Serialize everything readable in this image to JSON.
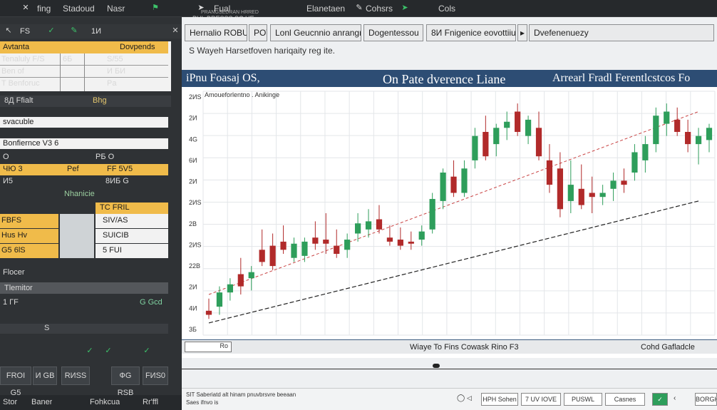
{
  "topbar": {
    "items": [
      "fing",
      "Stadoud",
      "Nasr",
      "Fual",
      "Elanetaen",
      "Cohsrs",
      "Cols"
    ],
    "subtitle": "PHI. BRESSS   SC HE",
    "tiny": "PRANGSEDRAN HRRED"
  },
  "left": {
    "toolbar": [
      "FS",
      "✓",
      "1И"
    ],
    "table": {
      "header_left": "Avtanta",
      "header_right": "Dovpends",
      "rows": [
        {
          "a": "Tenaluly F/S",
          "b": "6Б",
          "c": "S/55"
        },
        {
          "a": "Ben of",
          "b": "",
          "c": "И БИ"
        },
        {
          "a": "T Benforuc",
          "b": "",
          "c": "Pa"
        }
      ]
    },
    "section1": {
      "title": "Bhg",
      "label": "8Д Ffialt",
      "item1": "svacuble",
      "item2": "Bonfiernce V3 6"
    },
    "row_o": {
      "left": "O",
      "right": "PБ O"
    },
    "yellow_row": {
      "a": "ЧЮ 3",
      "b": "Pef",
      "c": "FF 5V5"
    },
    "small_row": {
      "left": "И5",
      "right": "8ИБ G"
    },
    "section2": {
      "title": "Nhanicie",
      "right_title": "TC FRIL"
    },
    "grid2": [
      {
        "a": "FBFS",
        "b": "SIV/AS"
      },
      {
        "a": "Hus Hv",
        "b": "SUICIB"
      },
      {
        "a": "G5 6lS",
        "b": "5 FUI"
      }
    ],
    "fields": {
      "label": "Flocer",
      "input": "Tlemitor"
    },
    "row_b": {
      "left": "1 ГF",
      "right": "G Gcd"
    },
    "row_c": {
      "value": "S"
    },
    "bottom_buttons": [
      "FROI G5",
      "И GB",
      "RИSS",
      "ФG RSB",
      "FИS0"
    ],
    "footer": [
      "Stor",
      "Baner",
      "Fohkcua",
      "Rr'ffl"
    ]
  },
  "main": {
    "tabs": [
      "Hernalio ROBU",
      "POT",
      "Lonl Geucnnio anrangrs",
      "Dogentessou",
      "8И Fnigenice eovottiiul",
      "Dvefenenuezy"
    ],
    "breadcrumb": "S Wayeh Harsetfoven hariqaity reg ite.",
    "title_left": "iPnu Foasaj OS,",
    "title_center": "On Pate dverence Liane",
    "title_right": "Arrearl Fradl Ferentlcstcos Fo",
    "legend": "Amoueforlentno . Anikinge",
    "status_center": "Wiaye To Fins Cowask Rino F3",
    "status_right": "Cohd Gafladcle",
    "status_left_btn": "Ro",
    "bottom_note1": "SIT Saberiatd alt hinam pnuvbrsvre beeaan",
    "bottom_note2": "Saes ifnvo is",
    "bottom_buttons": [
      "HPH Sohen",
      "7 UV IOVE",
      "PUSWL",
      "Casnes",
      "✓",
      "BORGHN"
    ]
  },
  "chart_data": {
    "type": "candlestick",
    "title": "On Pate dverence Liane",
    "y_tick_labels": [
      "2ИS",
      "2И",
      "4G",
      "6И",
      "2И",
      "2ИS",
      "2B",
      "2ИS",
      "22B",
      "2И",
      "4И",
      "3Б"
    ],
    "candles": [
      {
        "o": 22,
        "h": 28,
        "l": 18,
        "c": 20,
        "up": false
      },
      {
        "o": 24,
        "h": 34,
        "l": 20,
        "c": 31,
        "up": true
      },
      {
        "o": 31,
        "h": 38,
        "l": 27,
        "c": 35,
        "up": true
      },
      {
        "o": 40,
        "h": 48,
        "l": 30,
        "c": 34,
        "up": false
      },
      {
        "o": 38,
        "h": 44,
        "l": 32,
        "c": 41,
        "up": true
      },
      {
        "o": 52,
        "h": 62,
        "l": 44,
        "c": 46,
        "up": false
      },
      {
        "o": 54,
        "h": 60,
        "l": 42,
        "c": 44,
        "up": false
      },
      {
        "o": 56,
        "h": 64,
        "l": 50,
        "c": 52,
        "up": false
      },
      {
        "o": 48,
        "h": 58,
        "l": 46,
        "c": 55,
        "up": true
      },
      {
        "o": 49,
        "h": 58,
        "l": 46,
        "c": 56,
        "up": true
      },
      {
        "o": 55,
        "h": 66,
        "l": 52,
        "c": 58,
        "up": false
      },
      {
        "o": 55,
        "h": 70,
        "l": 50,
        "c": 57,
        "up": false
      },
      {
        "o": 54,
        "h": 62,
        "l": 48,
        "c": 50,
        "up": false
      },
      {
        "o": 52,
        "h": 60,
        "l": 48,
        "c": 57,
        "up": true
      },
      {
        "o": 60,
        "h": 70,
        "l": 56,
        "c": 65,
        "up": true
      },
      {
        "o": 62,
        "h": 72,
        "l": 58,
        "c": 66,
        "up": true
      },
      {
        "o": 67,
        "h": 74,
        "l": 60,
        "c": 62,
        "up": false
      },
      {
        "o": 58,
        "h": 64,
        "l": 54,
        "c": 56,
        "up": false
      },
      {
        "o": 57,
        "h": 63,
        "l": 52,
        "c": 54,
        "up": false
      },
      {
        "o": 56,
        "h": 61,
        "l": 52,
        "c": 55,
        "up": false
      },
      {
        "o": 57,
        "h": 64,
        "l": 54,
        "c": 61,
        "up": true
      },
      {
        "o": 62,
        "h": 80,
        "l": 60,
        "c": 77,
        "up": true
      },
      {
        "o": 76,
        "h": 92,
        "l": 72,
        "c": 90,
        "up": true
      },
      {
        "o": 88,
        "h": 96,
        "l": 78,
        "c": 80,
        "up": false
      },
      {
        "o": 80,
        "h": 96,
        "l": 78,
        "c": 92,
        "up": true
      },
      {
        "o": 96,
        "h": 112,
        "l": 92,
        "c": 108,
        "up": true
      },
      {
        "o": 110,
        "h": 118,
        "l": 96,
        "c": 98,
        "up": false
      },
      {
        "o": 104,
        "h": 114,
        "l": 98,
        "c": 112,
        "up": true
      },
      {
        "o": 112,
        "h": 120,
        "l": 106,
        "c": 115,
        "up": true
      },
      {
        "o": 120,
        "h": 124,
        "l": 108,
        "c": 110,
        "up": false
      },
      {
        "o": 108,
        "h": 118,
        "l": 104,
        "c": 116,
        "up": true
      },
      {
        "o": 112,
        "h": 120,
        "l": 96,
        "c": 98,
        "up": false
      },
      {
        "o": 96,
        "h": 104,
        "l": 80,
        "c": 84,
        "up": false
      },
      {
        "o": 92,
        "h": 100,
        "l": 68,
        "c": 72,
        "up": false
      },
      {
        "o": 84,
        "h": 96,
        "l": 70,
        "c": 76,
        "up": true
      },
      {
        "o": 82,
        "h": 94,
        "l": 72,
        "c": 74,
        "up": false
      },
      {
        "o": 80,
        "h": 88,
        "l": 70,
        "c": 78,
        "up": false
      },
      {
        "o": 78,
        "h": 84,
        "l": 74,
        "c": 80,
        "up": true
      },
      {
        "o": 82,
        "h": 90,
        "l": 76,
        "c": 86,
        "up": true
      },
      {
        "o": 86,
        "h": 92,
        "l": 80,
        "c": 84,
        "up": false
      },
      {
        "o": 90,
        "h": 104,
        "l": 86,
        "c": 100,
        "up": true
      },
      {
        "o": 96,
        "h": 108,
        "l": 90,
        "c": 104,
        "up": true
      },
      {
        "o": 104,
        "h": 122,
        "l": 100,
        "c": 118,
        "up": true
      },
      {
        "o": 114,
        "h": 124,
        "l": 108,
        "c": 120,
        "up": true
      },
      {
        "o": 116,
        "h": 122,
        "l": 108,
        "c": 110,
        "up": false
      },
      {
        "o": 110,
        "h": 116,
        "l": 100,
        "c": 104,
        "up": false
      },
      {
        "o": 104,
        "h": 112,
        "l": 94,
        "c": 108,
        "up": true
      },
      {
        "o": 106,
        "h": 114,
        "l": 100,
        "c": 112,
        "up": true
      }
    ],
    "trend_lower": [
      [
        0,
        16
      ],
      [
        46,
        76
      ]
    ],
    "trend_upper": [
      [
        0,
        30
      ],
      [
        46,
        120
      ]
    ],
    "ylim": [
      10,
      130
    ]
  },
  "colors": {
    "up": "#2e9e5b",
    "down": "#b12a2a",
    "titlebar": "#2d4d74",
    "panel": "#2f3235",
    "accent": "#f0bb4a"
  }
}
